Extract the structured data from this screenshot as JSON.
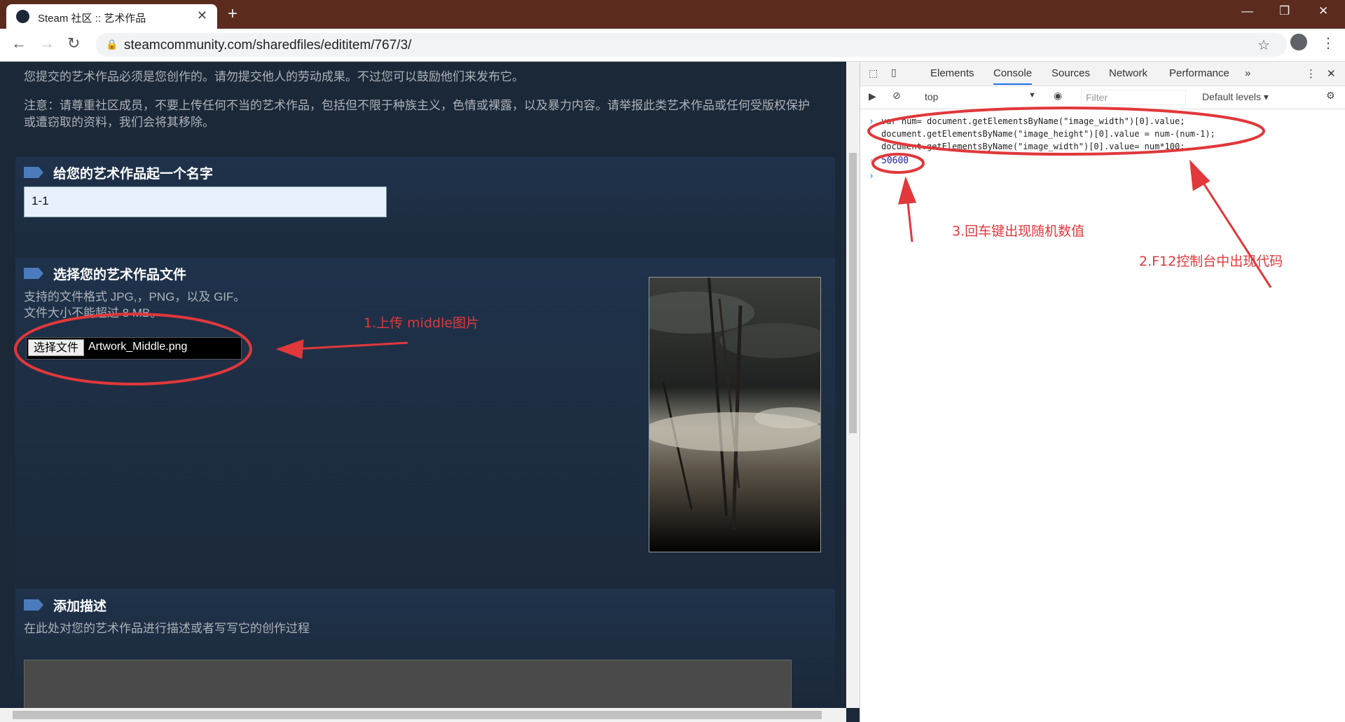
{
  "browser": {
    "tab_title": "Steam 社区 :: 艺术作品",
    "new_tab": "+",
    "close_tab": "✕",
    "url": "steamcommunity.com/sharedfiles/edititem/767/3/",
    "window_controls": [
      "—",
      "❐",
      "✕"
    ]
  },
  "page": {
    "intro_line1": "您提交的艺术作品必须是您创作的。请勿提交他人的劳动成果。不过您可以鼓励他们来发布它。",
    "intro_line2": "注意：请尊重社区成员，不要上传任何不当的艺术作品，包括但不限于种族主义，色情或裸露，以及暴力内容。请举报此类艺术作品或任何受版权保护",
    "intro_line3": "或遭窃取的资料，我们会将其移除。",
    "name_section_title": "给您的艺术作品起一个名字",
    "name_value": "1-1",
    "file_section_title": "选择您的艺术作品文件",
    "file_formats": "支持的文件格式 JPG,，PNG，以及 GIF。",
    "file_size": "文件大小不能超过 8 MB。",
    "file_button": "选择文件",
    "file_name": "Artwork_Middle.png",
    "desc_section_title": "添加描述",
    "desc_hint": "在此处对您的艺术作品进行描述或者写写它的创作过程"
  },
  "devtools": {
    "tabs": [
      "Elements",
      "Console",
      "Sources",
      "Network",
      "Performance"
    ],
    "active_tab": "Console",
    "more": "»",
    "context": "top",
    "filter_placeholder": "Filter",
    "levels": "Default levels ▾",
    "code": [
      "var num= document.getElementsByName(\"image_width\")[0].value;",
      "document.getElementsByName(\"image_height\")[0].value = num-(num-1);",
      "document.getElementsByName(\"image_width\")[0].value= num*100;"
    ],
    "result": "50600"
  },
  "annotations": {
    "step1": "1.上传 middle图片",
    "step2": "2.F12控制台中出现代码",
    "step3": "3.回车键出现随机数值"
  },
  "colors": {
    "annotation": "#e0383b",
    "page_bg": "#1b2838",
    "accent": "#4b7bbd"
  }
}
